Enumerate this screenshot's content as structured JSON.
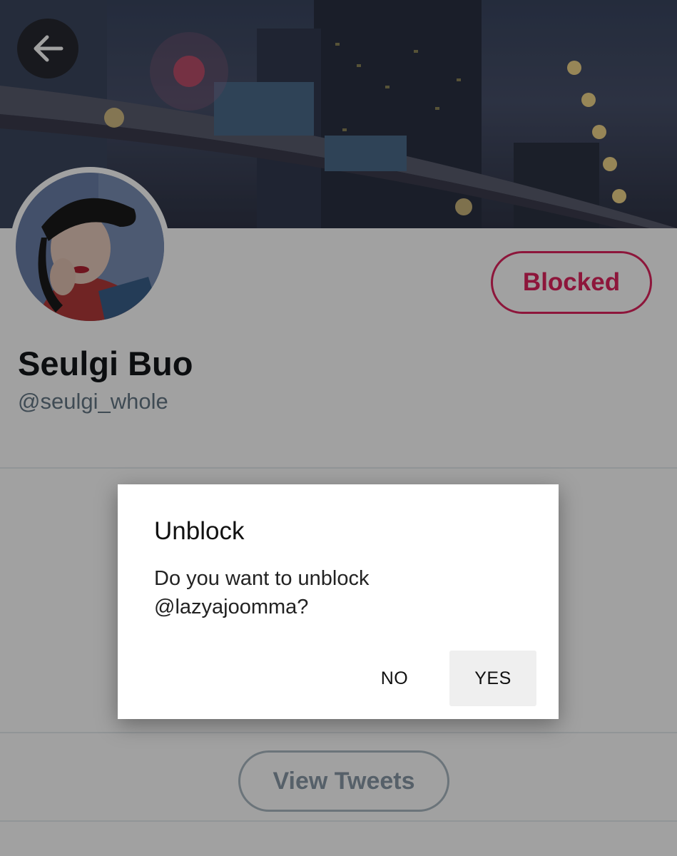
{
  "profile": {
    "display_name": "Seulgi Buo",
    "handle": "@seulgi_whole",
    "blocked_label": "Blocked",
    "view_tweets_label": "View Tweets",
    "back_icon": "arrow-left-icon"
  },
  "dialog": {
    "title": "Unblock",
    "message": "Do you want to unblock @lazyajoomma?",
    "no_label": "NO",
    "yes_label": "YES"
  },
  "colors": {
    "blocked_accent": "#e0245e",
    "scrim": "rgba(0,0,0,0.37)",
    "yes_button_bg": "#efefef"
  }
}
